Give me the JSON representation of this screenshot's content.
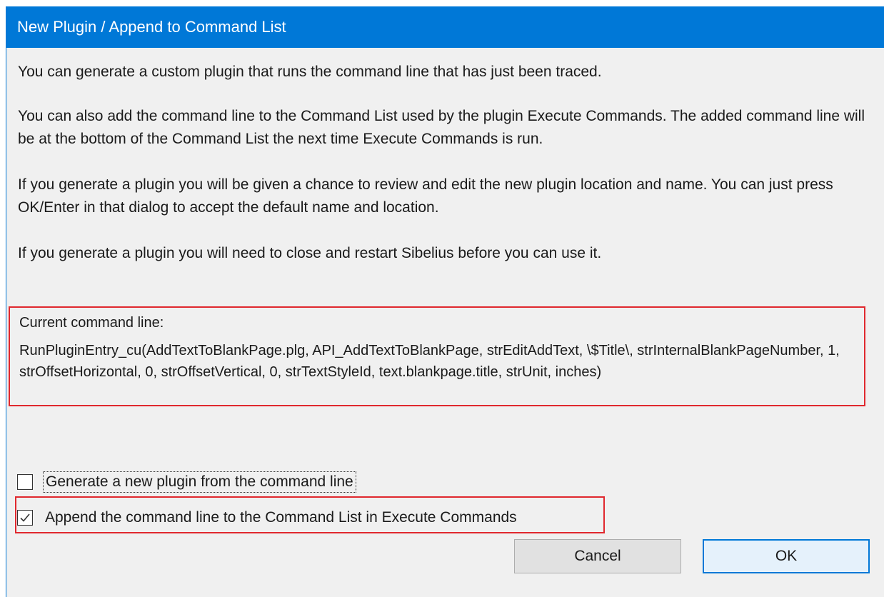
{
  "dialog": {
    "title": "New Plugin / Append to Command List",
    "paragraphs": [
      "You can generate a custom plugin that runs the command line that has just been traced.",
      "You can also add the command line to the Command List used by the plugin Execute Commands. The added command line will be at the bottom of the Command List the next time Execute Commands is run.",
      "If you generate a plugin you will be given a chance to review and edit the new plugin location and name. You can just press OK/Enter in that dialog to accept the default name and location.",
      "If you generate a plugin you will need to close and restart Sibelius before you can use it."
    ],
    "command_label": "Current command line:",
    "command_text": "RunPluginEntry_cu(AddTextToBlankPage.plg, API_AddTextToBlankPage, strEditAddText, \\$Title\\, strInternalBlankPageNumber, 1, strOffsetHorizontal, 0, strOffsetVertical, 0, strTextStyleId, text.blankpage.title, strUnit, inches)",
    "options": [
      {
        "label": "Generate a new plugin from the command line",
        "checked": false
      },
      {
        "label": "Append the command line to the Command List in Execute Commands",
        "checked": true
      }
    ],
    "buttons": {
      "cancel": "Cancel",
      "ok": "OK"
    }
  },
  "colors": {
    "titlebar": "#0078d7",
    "highlight": "#e0282e",
    "background": "#f0f0f0"
  }
}
